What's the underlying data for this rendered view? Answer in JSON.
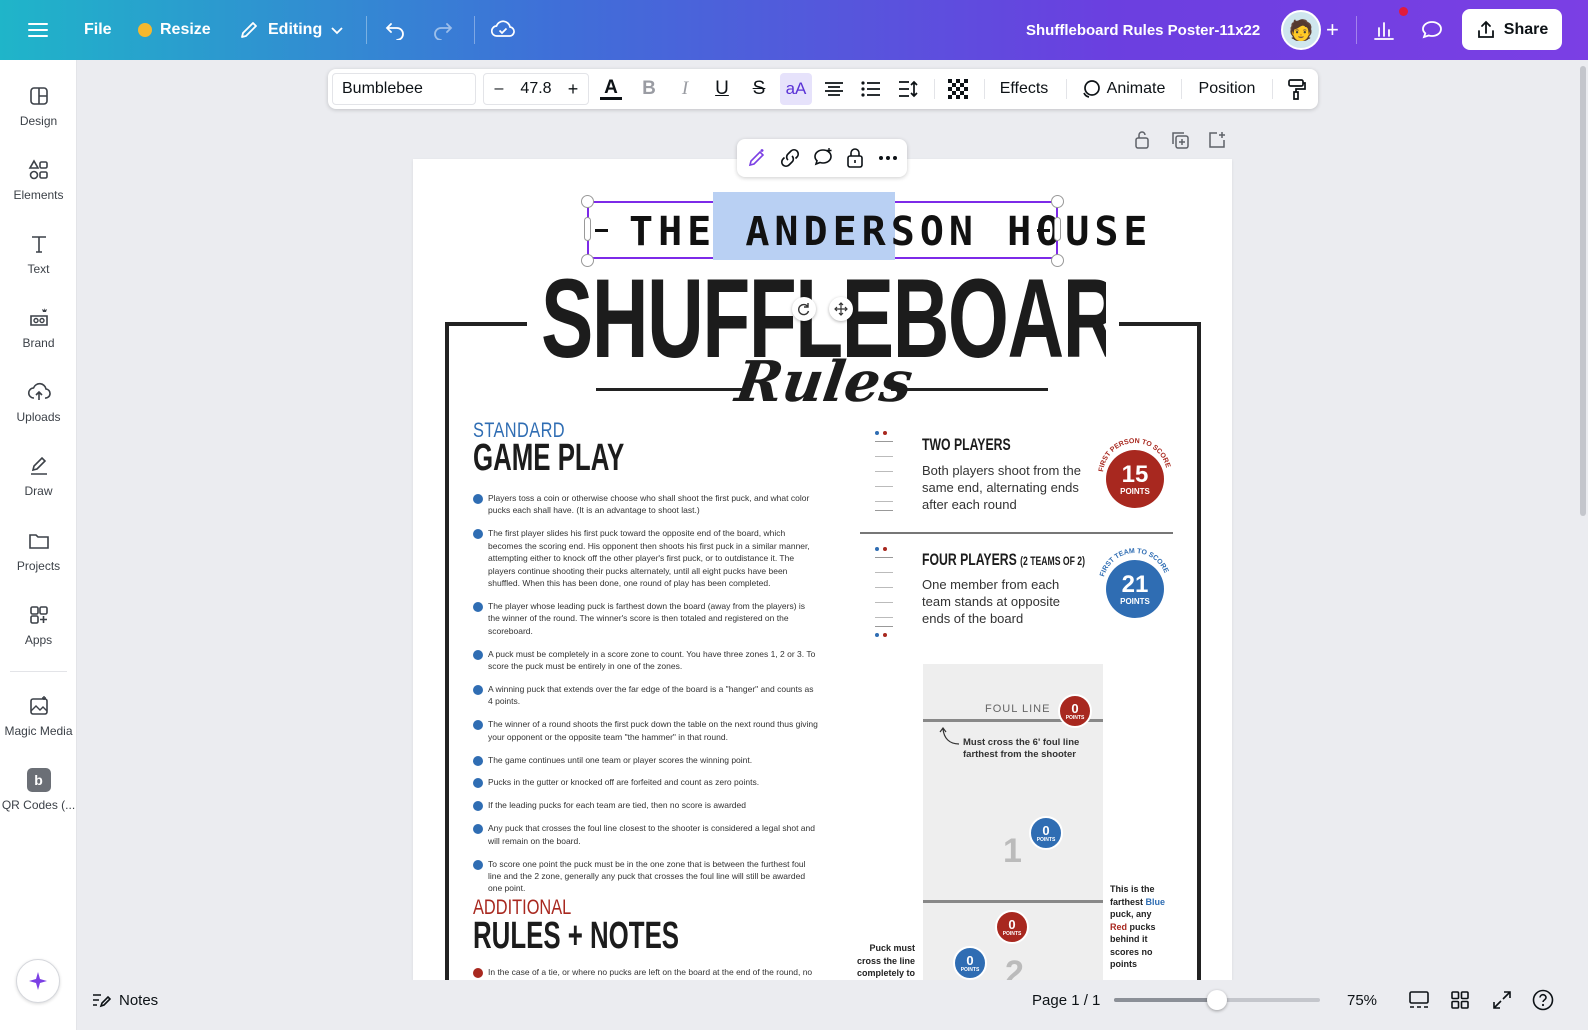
{
  "topbar": {
    "menu_icon": "hamburger-icon",
    "file_label": "File",
    "resize_label": "Resize",
    "editing_label": "Editing",
    "doc_title": "Shuffleboard Rules Poster-11x22",
    "share_label": "Share",
    "gradient_start": "#1fb5c9",
    "gradient_end": "#7b3fe4"
  },
  "sidebar": {
    "items": [
      {
        "label": "Design",
        "icon": "design-icon"
      },
      {
        "label": "Elements",
        "icon": "elements-icon"
      },
      {
        "label": "Text",
        "icon": "text-icon"
      },
      {
        "label": "Brand",
        "icon": "brand-icon"
      },
      {
        "label": "Uploads",
        "icon": "uploads-icon"
      },
      {
        "label": "Draw",
        "icon": "draw-icon"
      },
      {
        "label": "Projects",
        "icon": "projects-icon"
      },
      {
        "label": "Apps",
        "icon": "apps-icon"
      },
      {
        "label": "Magic Media",
        "icon": "magic-media-icon"
      },
      {
        "label": "QR Codes (...",
        "icon": "qr-codes-icon"
      }
    ]
  },
  "format_toolbar": {
    "font_name": "Bumblebee",
    "font_size": "47.8",
    "minus": "–",
    "plus": "+",
    "bold": "B",
    "italic": "I",
    "underline": "U",
    "strike": "S",
    "case": "aA",
    "effects_label": "Effects",
    "animate_label": "Animate",
    "position_label": "Position"
  },
  "poster": {
    "header_pre": "THE",
    "header_selected": "ANDERSON",
    "header_post": "HOUSE",
    "big_title": "SHUFFLEBOARD",
    "script_title": "Rules",
    "standard_label": "STANDARD",
    "game_play_label": "GAME PLAY",
    "rules": [
      "Players toss a coin or otherwise choose who shall shoot the first puck, and what color pucks each shall have. (It is an advantage to shoot last.)",
      "The first player slides his first puck toward the opposite end of the board, which becomes the scoring end. His opponent then shoots his first puck in a similar manner, attempting either to knock off the other player's first puck, or to outdistance it. The players continue shooting their pucks alternately, until all eight pucks have been shuffled. When this has been done, one round of play has been completed.",
      "The player whose leading puck is farthest down the board (away from the players) is the winner of the round. The winner's score is then totaled and registered on the scoreboard.",
      "A puck must be completely in a score zone to count. You have three zones 1, 2 or 3. To score the puck must be entirely in one of the zones.",
      "A winning puck that extends over the far edge of the board is a \"hanger\" and counts as 4 points.",
      "The winner of a round shoots the first puck down the table on the next round thus giving your opponent or the opposite team \"the hammer\" in that round.",
      "The game continues until one team or player scores the winning point.",
      "Pucks in the gutter or knocked off are forfeited and count as zero points.",
      "If the leading pucks for each team are tied, then no score is awarded",
      "Any puck that crosses the foul line closest to the shooter is considered a legal shot and will remain on the board.",
      "To score one point the puck must be in the one zone that is between the furthest foul line and the 2 zone, generally any puck that crosses the foul line will still be awarded one point."
    ],
    "additional_label": "ADDITIONAL",
    "rules_notes_label": "RULES + NOTES",
    "tie_text": "In the case of a tie, or where no pucks are left on the board at the end of the round, no",
    "two_players_title": "TWO PLAYERS",
    "two_players_text": "Both players shoot from the same end, alternating ends after each round",
    "two_players_arc": "FIRST PERSON TO SCORE",
    "two_players_points": "15",
    "four_players_title": "FOUR PLAYERS",
    "four_players_sub": "(2 TEAMS OF 2)",
    "four_players_text": "One member from each team stands at opposite ends of the board",
    "four_players_arc": "FIRST TEAM TO SCORE",
    "four_players_points": "21",
    "points_word": "POINTS",
    "foul_line_label": "FOUL LINE",
    "must_cross_text": "Must cross the 6' foul line farthest from the shooter",
    "zone_1": "1",
    "zone_2": "2",
    "zero": "0",
    "farthest_pre": "This is the farthest",
    "farthest_blue": "Blue",
    "farthest_mid": "puck, any",
    "farthest_red": "Red",
    "farthest_post": "pucks behind it scores no points",
    "puck_must_text": "Puck must cross the line completely to",
    "red": "#a8281f",
    "blue": "#2f6db3"
  },
  "bottom": {
    "notes_label": "Notes",
    "page_label": "Page 1 / 1",
    "zoom_label": "75%",
    "zoom_fraction": 0.5
  }
}
